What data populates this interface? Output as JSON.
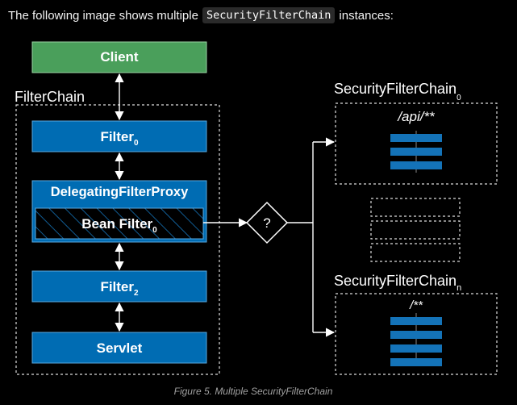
{
  "intro": {
    "text_before": "The following image shows multiple",
    "code": "SecurityFilterChain",
    "text_after": "instances:"
  },
  "diagram": {
    "client_label": "Client",
    "filterchain_label": "FilterChain",
    "filter0": {
      "name": "Filter",
      "sub": "0"
    },
    "proxy_label": "DelegatingFilterProxy",
    "bean_filter": {
      "name": "Bean Filter",
      "sub": "0"
    },
    "filter2": {
      "name": "Filter",
      "sub": "2"
    },
    "servlet_label": "Servlet",
    "decision_symbol": "?",
    "chain0": {
      "title": "SecurityFilterChain",
      "sub": "0",
      "pattern": "/api/**"
    },
    "chainN": {
      "title": "SecurityFilterChain",
      "sub": "n",
      "pattern": "/**"
    }
  },
  "caption": "Figure 5. Multiple SecurityFilterChain",
  "colors": {
    "client_green": "#4a9f5b",
    "filter_blue": "#006cb3",
    "bar_blue": "#1473b8",
    "background": "#000000"
  }
}
